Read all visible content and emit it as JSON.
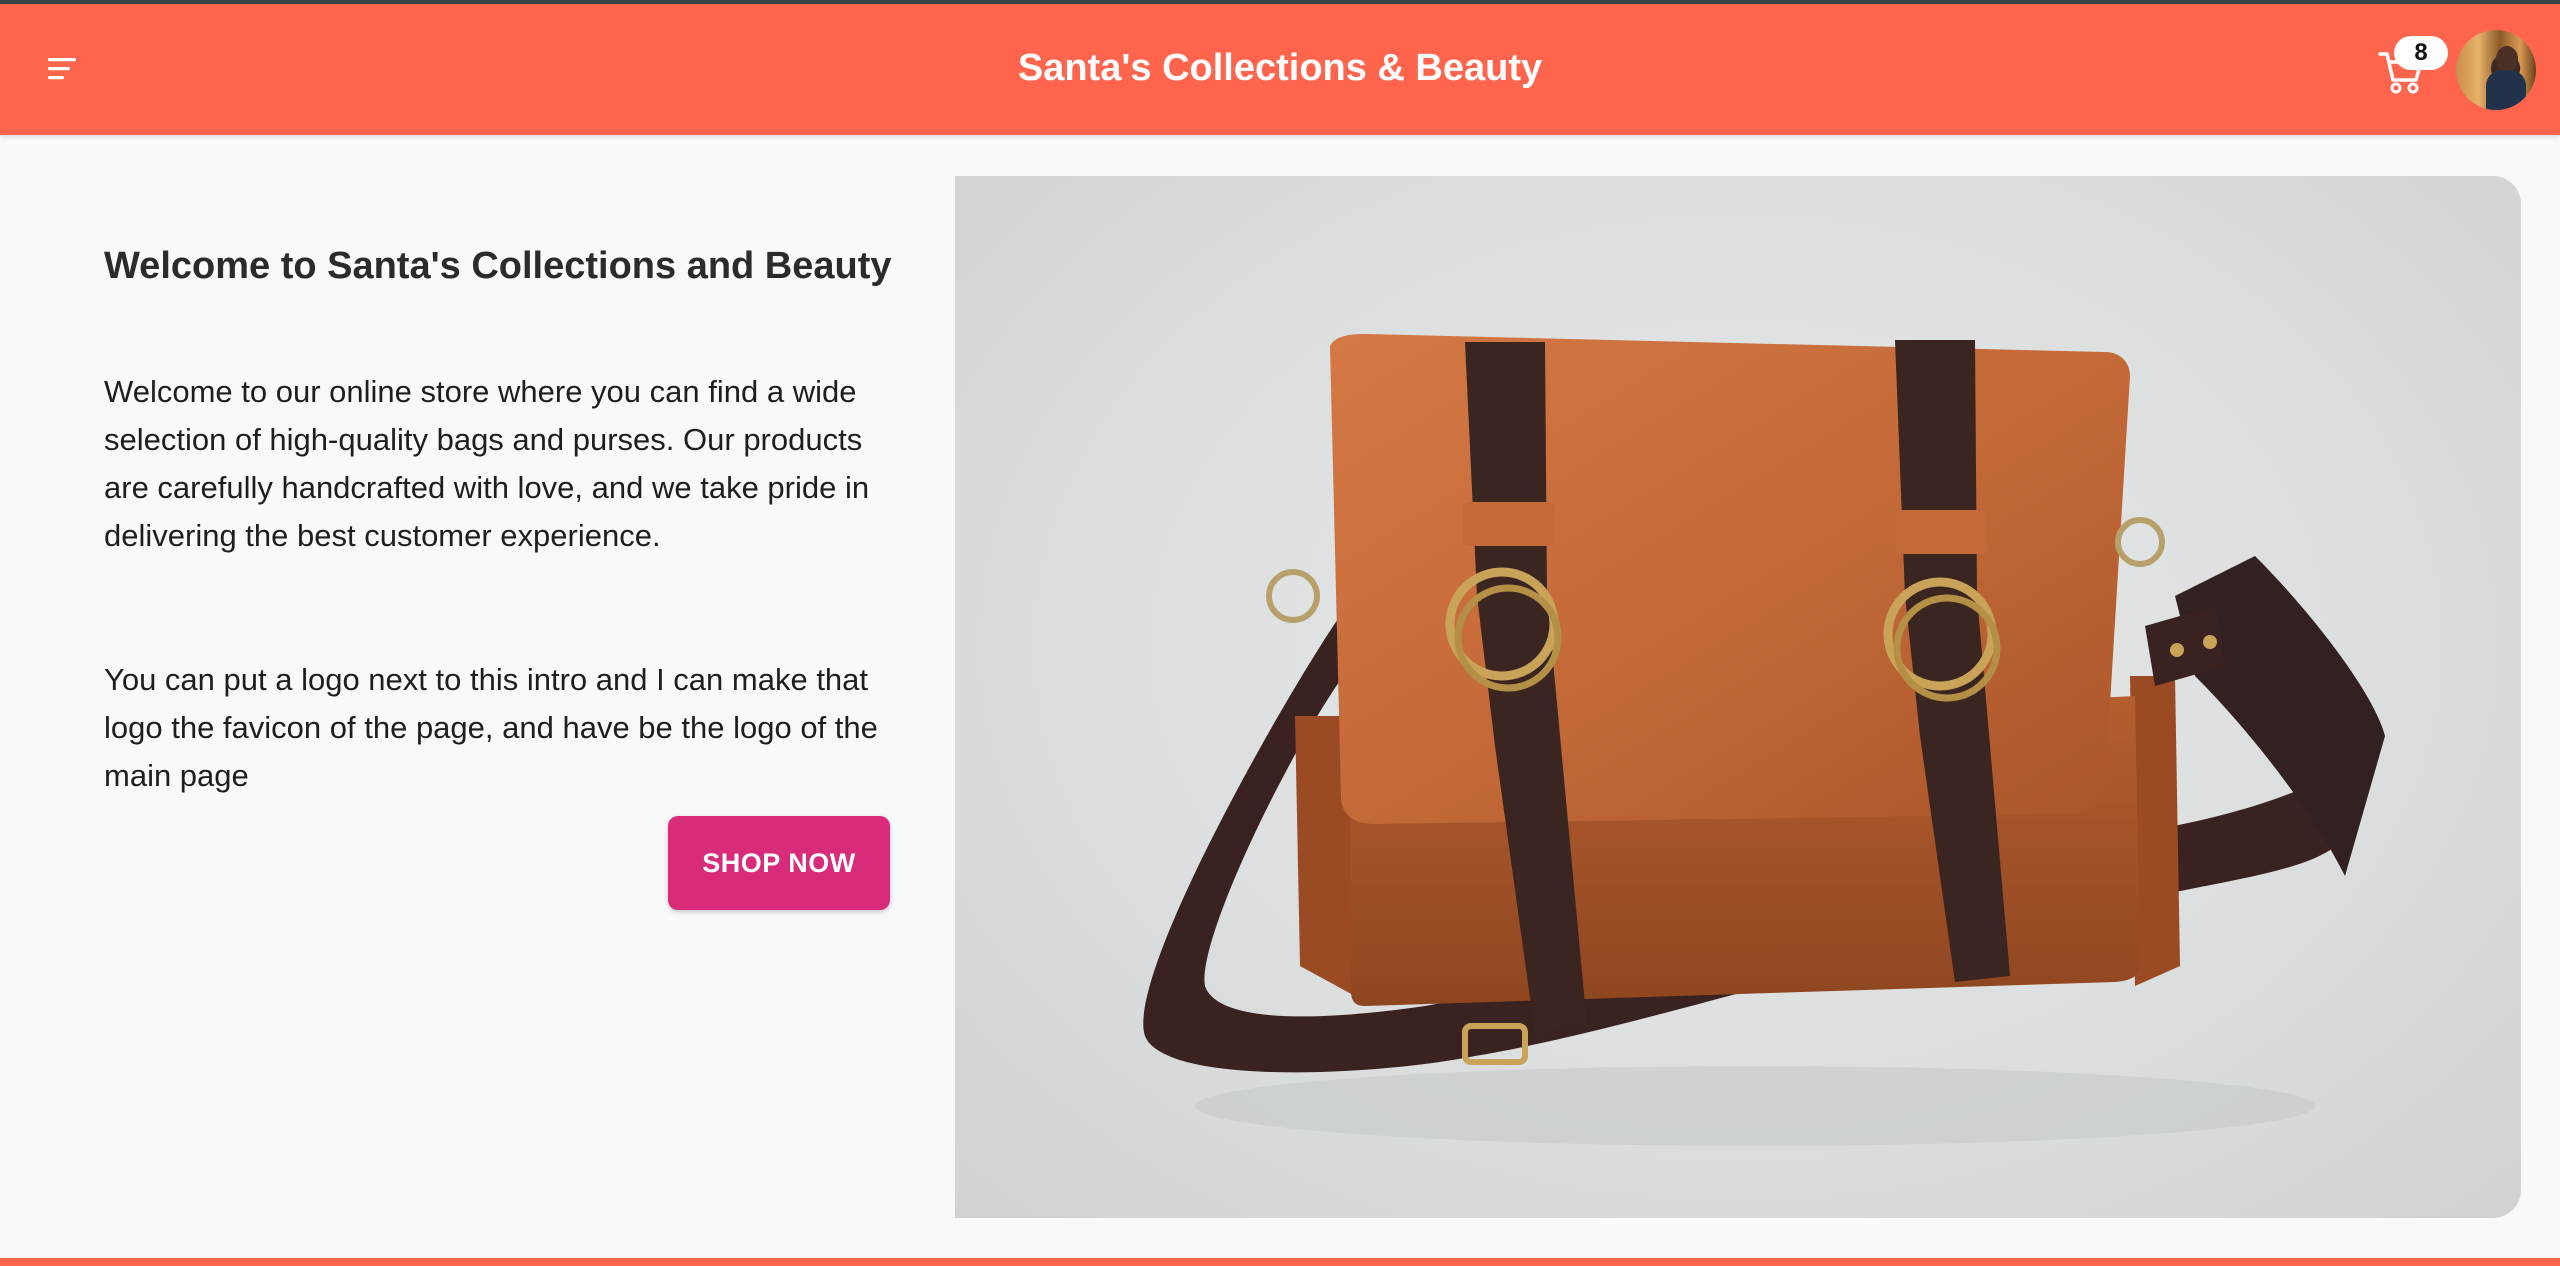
{
  "header": {
    "title": "Santa's Collections & Beauty",
    "cart_count": "8",
    "menu_icon": "hamburger-menu-icon",
    "cart_icon": "shopping-cart-icon",
    "avatar": "user-avatar"
  },
  "hero": {
    "title": "Welcome to Santa's Collections and Beauty",
    "paragraph1": "Welcome to our online store where you can find a wide selection of high-quality bags and purses. Our products are carefully handcrafted with love, and we take pride in delivering the best customer experience.",
    "paragraph2": "You can put a logo next to this intro and I can make that logo the favicon of the page, and have be the logo of the main page",
    "button_label": "SHOP NOW"
  },
  "colors": {
    "header_bg": "#ff644c",
    "button_bg": "#d82b7a",
    "page_bg": "#f8f9fb"
  }
}
